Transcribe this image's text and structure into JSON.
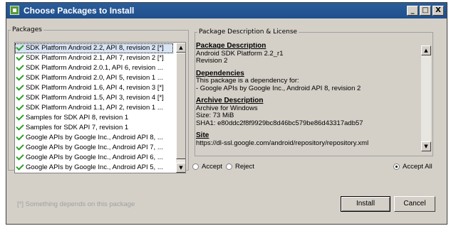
{
  "window": {
    "title": "Choose Packages to Install"
  },
  "title_buttons": {
    "minimize": "_",
    "maximize": "□",
    "close": "X"
  },
  "packages": {
    "legend": "Packages",
    "items": [
      {
        "label": "SDK Platform Android 2.2, API 8, revision 2 [*]",
        "selected": true
      },
      {
        "label": "SDK Platform Android 2.1, API 7, revision 2 [*]"
      },
      {
        "label": "SDK Platform Android 2.0.1, API 6, revision ..."
      },
      {
        "label": "SDK Platform Android 2.0, API 5, revision 1 ..."
      },
      {
        "label": "SDK Platform Android 1.6, API 4, revision 3 [*]"
      },
      {
        "label": "SDK Platform Android 1.5, API 3, revision 4 [*]"
      },
      {
        "label": "SDK Platform Android 1.1, API 2, revision 1 ..."
      },
      {
        "label": "Samples for SDK API 8, revision 1"
      },
      {
        "label": "Samples for SDK API 7, revision 1"
      },
      {
        "label": "Google APIs by Google Inc., Android API 8, ..."
      },
      {
        "label": "Google APIs by Google Inc., Android API 7, ..."
      },
      {
        "label": "Google APIs by Google Inc., Android API 6, ..."
      },
      {
        "label": "Google APIs by Google Inc., Android API 5, ..."
      }
    ]
  },
  "description": {
    "legend": "Package Description & License",
    "sections": [
      {
        "heading": "Package Description",
        "lines": [
          "Android SDK Platform 2.2_r1",
          "Revision 2"
        ]
      },
      {
        "heading": "Dependencies",
        "lines": [
          "This package is a dependency for:",
          "- Google APIs by Google Inc., Android API 8, revision 2"
        ]
      },
      {
        "heading": "Archive Description",
        "lines": [
          "Archive for Windows",
          "Size: 73 MiB",
          "SHA1: e80ddc2f8f9929bc8d46bc579be86d43317adb57"
        ]
      },
      {
        "heading": "Site",
        "lines": [
          "https://dl-ssl.google.com/android/repository/repository.xml"
        ]
      }
    ]
  },
  "options": {
    "accept": "Accept",
    "reject": "Reject",
    "accept_all": "Accept All",
    "selected": "accept_all"
  },
  "footnote": "[*] Something depends on this package",
  "buttons": {
    "install": "Install",
    "cancel": "Cancel"
  },
  "colors": {
    "titlebar": "#1f4f8c",
    "check": "#2da12a",
    "face": "#d4d0c8"
  }
}
